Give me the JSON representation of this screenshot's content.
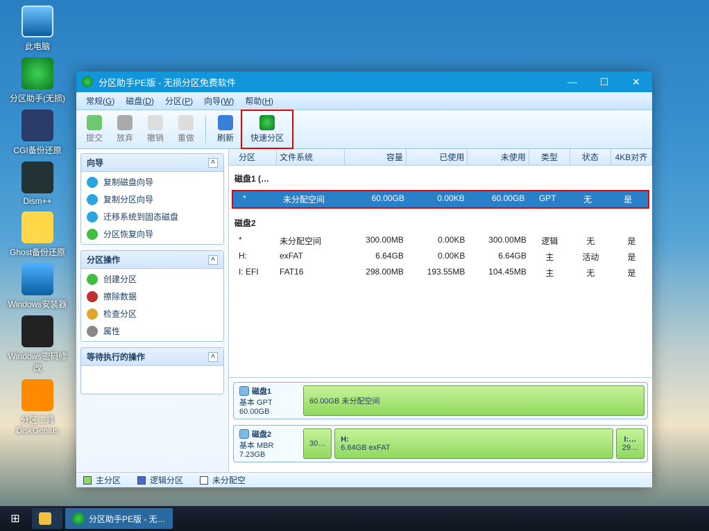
{
  "desktop": {
    "icons": [
      {
        "label": "此电脑"
      },
      {
        "label": "分区助手(无损)"
      },
      {
        "label": "CGI备份还原"
      },
      {
        "label": "Dism++"
      },
      {
        "label": "Ghost备份还原"
      },
      {
        "label": "Windows安装器"
      },
      {
        "label": "Windows密码修改"
      },
      {
        "label": "分区工具DiskGenius"
      }
    ]
  },
  "window": {
    "title": "分区助手PE版 - 无损分区免费软件",
    "menus": [
      {
        "label": "常规",
        "key": "G"
      },
      {
        "label": "磁盘",
        "key": "D"
      },
      {
        "label": "分区",
        "key": "P"
      },
      {
        "label": "向导",
        "key": "W"
      },
      {
        "label": "帮助",
        "key": "H"
      }
    ],
    "toolbar": {
      "commit": "提交",
      "discard": "放弃",
      "undo": "撤销",
      "redo": "重做",
      "refresh": "刷新",
      "fast": "快速分区"
    }
  },
  "sidebar": {
    "wizard": {
      "title": "向导",
      "items": [
        "复制磁盘向导",
        "复制分区向导",
        "迁移系统到固态磁盘",
        "分区恢复向导"
      ]
    },
    "ops": {
      "title": "分区操作",
      "items": [
        "创建分区",
        "擦除数据",
        "检查分区",
        "属性"
      ]
    },
    "pending": {
      "title": "等待执行的操作"
    }
  },
  "grid": {
    "headers": [
      "分区",
      "文件系统",
      "容量",
      "已使用",
      "未使用",
      "类型",
      "状态",
      "4KB对齐"
    ],
    "disk1": {
      "title": "磁盘1 (…",
      "rows": [
        {
          "part": "*",
          "fs": "未分配空间",
          "cap": "60.00GB",
          "used": "0.00KB",
          "free": "60.00GB",
          "type": "GPT",
          "status": "无",
          "align": "是",
          "selected": true
        }
      ]
    },
    "disk2": {
      "title": "磁盘2",
      "rows": [
        {
          "part": "*",
          "fs": "未分配空间",
          "cap": "300.00MB",
          "used": "0.00KB",
          "free": "300.00MB",
          "type": "逻辑",
          "status": "无",
          "align": "是"
        },
        {
          "part": "H:",
          "fs": "exFAT",
          "cap": "6.64GB",
          "used": "0.00KB",
          "free": "6.64GB",
          "type": "主",
          "status": "活动",
          "align": "是"
        },
        {
          "part": "I: EFI",
          "fs": "FAT16",
          "cap": "298.00MB",
          "used": "193.55MB",
          "free": "104.45MB",
          "type": "主",
          "status": "无",
          "align": "是"
        }
      ]
    }
  },
  "diskmaps": {
    "d1": {
      "name": "磁盘1",
      "type": "基本 GPT",
      "size": "60.00GB",
      "seg": "60.00GB 未分配空间"
    },
    "d2": {
      "name": "磁盘2",
      "type": "基本 MBR",
      "size": "7.23GB",
      "seg0": "30…",
      "seg1a": "H:",
      "seg1b": "6.64GB exFAT",
      "seg2a": "I:…",
      "seg2b": "29…"
    }
  },
  "legend": {
    "primary": "主分区",
    "logical": "逻辑分区",
    "unalloc": "未分配空"
  },
  "taskbar": {
    "app": "分区助手PE版 - 无…"
  }
}
